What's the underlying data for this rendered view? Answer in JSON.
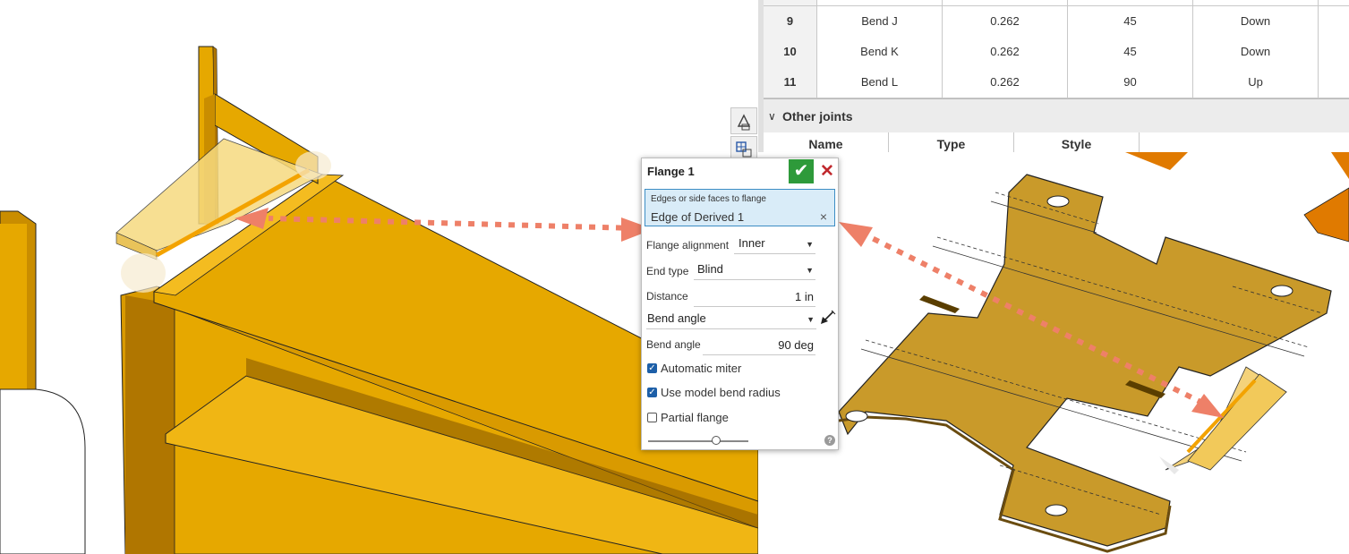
{
  "bend_table": {
    "rows": [
      {
        "index": "9",
        "name": "Bend J",
        "radius": "0.262",
        "angle": "45",
        "direction": "Down"
      },
      {
        "index": "10",
        "name": "Bend K",
        "radius": "0.262",
        "angle": "45",
        "direction": "Down"
      },
      {
        "index": "11",
        "name": "Bend L",
        "radius": "0.262",
        "angle": "90",
        "direction": "Up"
      }
    ]
  },
  "other_joints": {
    "label": "Other joints",
    "columns": [
      "Name",
      "Type",
      "Style"
    ]
  },
  "dialog": {
    "title": "Flange 1",
    "edges_label": "Edges or side faces to flange",
    "edges_value": "Edge of Derived 1",
    "clear_glyph": "×",
    "flange_alignment_label": "Flange alignment",
    "flange_alignment_value": "Inner",
    "end_type_label": "End type",
    "end_type_value": "Blind",
    "distance_label": "Distance",
    "distance_value": "1 in",
    "bend_mode_value": "Bend angle",
    "bend_angle_label": "Bend angle",
    "bend_angle_value": "90 deg",
    "automatic_miter_label": "Automatic miter",
    "automatic_miter_checked": true,
    "use_model_bend_radius_label": "Use model bend radius",
    "use_model_bend_radius_checked": true,
    "partial_flange_label": "Partial flange",
    "partial_flange_checked": false,
    "slider_level": 0.68,
    "help_glyph": "?"
  },
  "icons": {
    "ok": "check-icon",
    "cancel": "close-icon",
    "flip": "flip-direction-icon",
    "toolbar_1": "view-cube-icon",
    "toolbar_2": "section-grid-icon"
  },
  "colors": {
    "part_yellow": "#e6a800",
    "flat_pattern": "#c99a2a",
    "arrow": "#ee8068",
    "ok_green": "#2e9a3a",
    "cancel_red": "#c0282d",
    "selection_blue": "#d9ecf8"
  }
}
